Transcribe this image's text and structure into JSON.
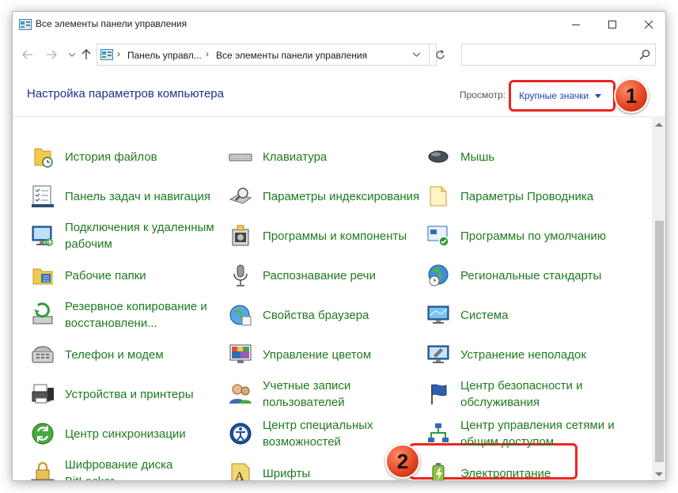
{
  "window": {
    "title": "Все элементы панели управления"
  },
  "address": {
    "crumbs": [
      "Панель управл...",
      "Все элементы панели управления"
    ],
    "search_placeholder": ""
  },
  "header": {
    "heading": "Настройка параметров компьютера",
    "view_label": "Просмотр:",
    "view_value": "Крупные значки"
  },
  "annotations": {
    "badge_1": "1",
    "badge_2": "2"
  },
  "colors": {
    "link_green": "#1f7a1f",
    "heading_blue": "#1e3287",
    "highlight_red": "#e8261f"
  },
  "items": [
    {
      "label": "История файлов",
      "icon": "file-history-icon"
    },
    {
      "label": "Клавиатура",
      "icon": "keyboard-icon"
    },
    {
      "label": "Мышь",
      "icon": "mouse-icon"
    },
    {
      "label": "Панель задач и навигация",
      "icon": "taskbar-icon"
    },
    {
      "label": "Параметры индексирования",
      "icon": "indexing-icon"
    },
    {
      "label": "Параметры Проводника",
      "icon": "explorer-options-icon"
    },
    {
      "label": "Подключения к удаленным рабочим",
      "icon": "remote-desktop-icon"
    },
    {
      "label": "Программы и компоненты",
      "icon": "programs-icon"
    },
    {
      "label": "Программы по умолчанию",
      "icon": "default-programs-icon"
    },
    {
      "label": "Рабочие папки",
      "icon": "work-folders-icon"
    },
    {
      "label": "Распознавание речи",
      "icon": "microphone-icon"
    },
    {
      "label": "Региональные стандарты",
      "icon": "region-globe-icon"
    },
    {
      "label": "Резервное копирование и восстановлени...",
      "icon": "backup-icon"
    },
    {
      "label": "Свойства браузера",
      "icon": "internet-options-icon"
    },
    {
      "label": "Система",
      "icon": "system-monitor-icon"
    },
    {
      "label": "Телефон и модем",
      "icon": "phone-modem-icon"
    },
    {
      "label": "Управление цветом",
      "icon": "color-management-icon"
    },
    {
      "label": "Устранение неполадок",
      "icon": "troubleshooting-icon"
    },
    {
      "label": "Устройства и принтеры",
      "icon": "printer-icon"
    },
    {
      "label": "Учетные записи пользователей",
      "icon": "user-accounts-icon"
    },
    {
      "label": "Центр безопасности и обслуживания",
      "icon": "security-flag-icon"
    },
    {
      "label": "Центр синхронизации",
      "icon": "sync-center-icon"
    },
    {
      "label": "Центр специальных возможностей",
      "icon": "ease-of-access-icon"
    },
    {
      "label": "Центр управления сетями и общим доступом",
      "icon": "network-center-icon"
    },
    {
      "label": "Шифрование диска BitLocker",
      "icon": "bitlocker-icon"
    },
    {
      "label": "Шрифты",
      "icon": "fonts-icon"
    },
    {
      "label": "Электропитание",
      "icon": "power-options-icon"
    }
  ]
}
